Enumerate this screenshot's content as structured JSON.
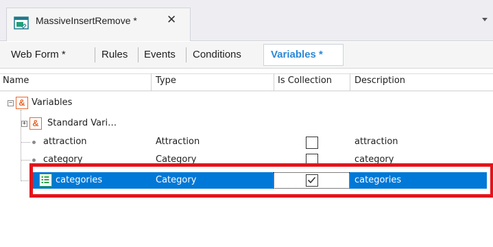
{
  "tab": {
    "title": "MassiveInsertRemove *",
    "close_glyph": "✕"
  },
  "subtabs": [
    {
      "label": "Web Form *"
    },
    {
      "label": "Rules"
    },
    {
      "label": "Events"
    },
    {
      "label": "Conditions"
    },
    {
      "label": "Variables *",
      "active": true
    }
  ],
  "grid": {
    "columns": [
      "Name",
      "Type",
      "Is Collection",
      "Description"
    ],
    "root": {
      "label": "Variables",
      "expander": "−",
      "icon": "&"
    },
    "rows": [
      {
        "name": "Standard Vari…",
        "type": "",
        "is_collection": null,
        "description": "",
        "icon": "ampersand-icon",
        "expander": "+"
      },
      {
        "name": "attraction",
        "type": "Attraction",
        "is_collection": false,
        "description": "attraction",
        "icon": "bullet-icon"
      },
      {
        "name": "category",
        "type": "Category",
        "is_collection": false,
        "description": "category",
        "icon": "bullet-icon"
      },
      {
        "name": "categories",
        "type": "Category",
        "is_collection": true,
        "description": "categories",
        "icon": "collection-icon",
        "selected": true
      }
    ]
  },
  "colors": {
    "accent": "#2b88d8",
    "selection": "#0078d7",
    "highlight_box": "#e3141a",
    "variable_icon": "#e8672b",
    "collection_icon": "#2ea44f"
  }
}
